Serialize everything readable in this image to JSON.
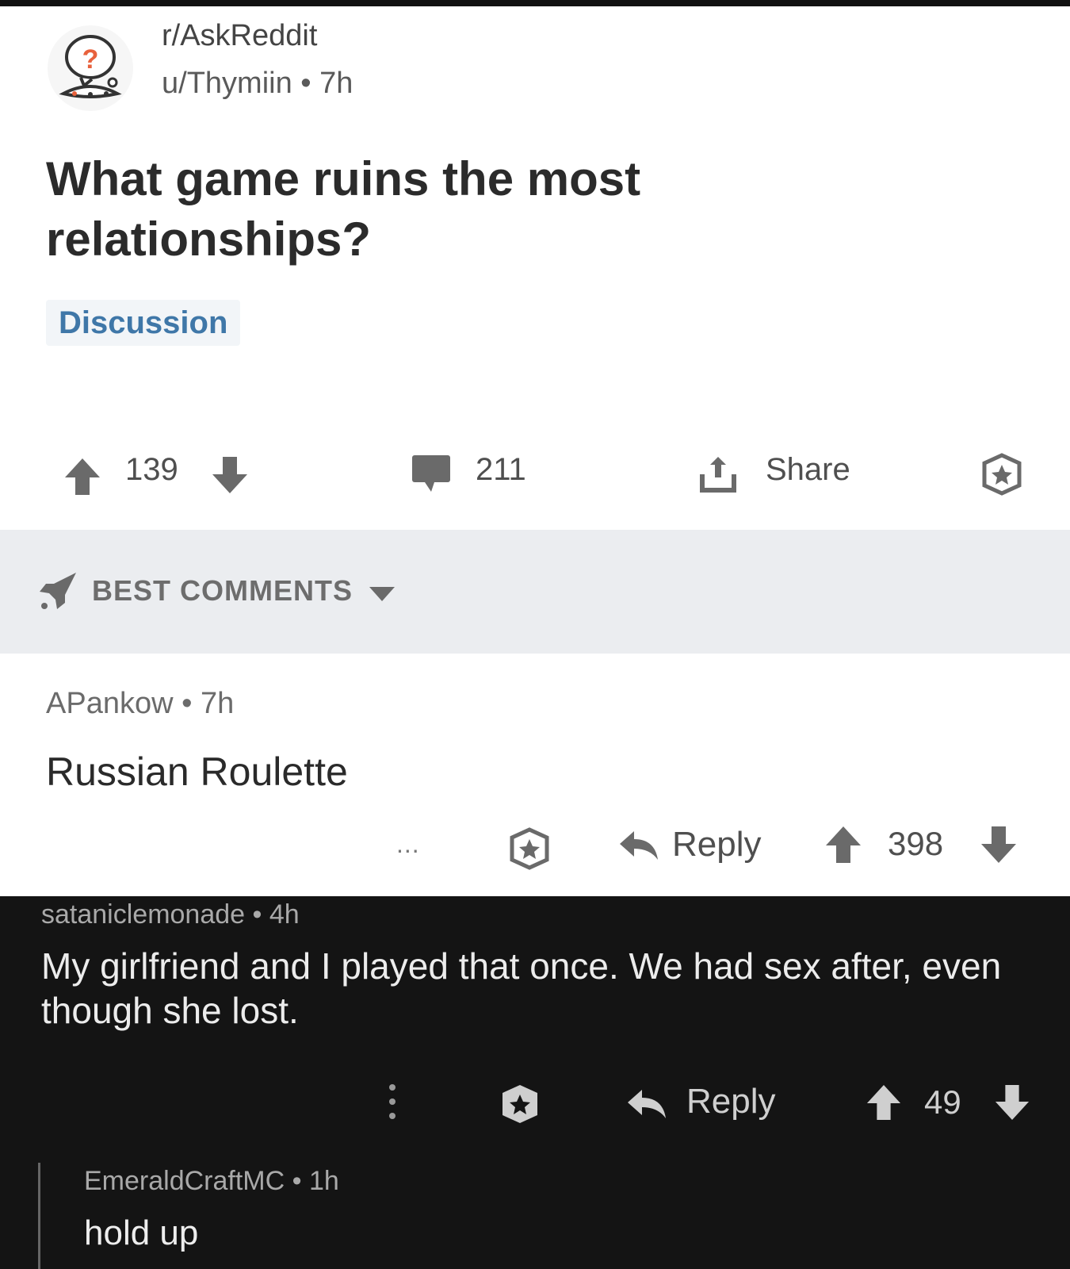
{
  "post": {
    "subreddit": "r/AskReddit",
    "author_time": "u/Thymiin • 7h",
    "title": "What game ruins the most relationships?",
    "flair": "Discussion",
    "score": "139",
    "comments": "211",
    "share_label": "Share"
  },
  "sort": {
    "label": "BEST COMMENTS"
  },
  "comments": [
    {
      "author_time": "APankow • 7h",
      "body": "Russian Roulette",
      "more": "...",
      "reply_label": "Reply",
      "score": "398"
    },
    {
      "author_time": "sataniclemonade • 4h",
      "body": "My girlfriend and I played that once. We had sex after, even though she lost.",
      "reply_label": "Reply",
      "score": "49"
    },
    {
      "author_time": "EmeraldCraftMC • 1h",
      "body": "hold up"
    }
  ],
  "icons": {
    "avatar": "askreddit-snoo-icon",
    "upvote": "arrow-up-icon",
    "downvote": "arrow-down-icon",
    "comment": "comment-bubble-icon",
    "share": "share-icon",
    "award": "award-icon",
    "sort": "rocket-icon",
    "reply": "reply-arrow-icon",
    "more": "more-options-icon"
  },
  "colors": {
    "flair_text": "#3f77a8",
    "dark_background": "#141414",
    "sort_bar": "#ebedf0"
  }
}
